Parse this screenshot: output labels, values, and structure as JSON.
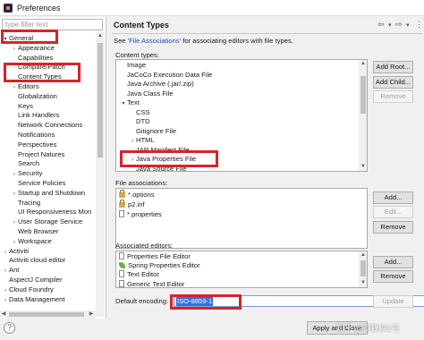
{
  "window": {
    "title": "Preferences"
  },
  "filter": {
    "placeholder": "type filter text"
  },
  "tree": [
    {
      "label": "General",
      "twisty": "down",
      "indent": 0
    },
    {
      "label": "Appearance",
      "twisty": "right",
      "indent": 1
    },
    {
      "label": "Capabilities",
      "twisty": "",
      "indent": 1
    },
    {
      "label": "Compare/Patch",
      "twisty": "",
      "indent": 1
    },
    {
      "label": "Content Types",
      "twisty": "",
      "indent": 1
    },
    {
      "label": "Editors",
      "twisty": "right",
      "indent": 1
    },
    {
      "label": "Globalization",
      "twisty": "",
      "indent": 1
    },
    {
      "label": "Keys",
      "twisty": "",
      "indent": 1
    },
    {
      "label": "Link Handlers",
      "twisty": "",
      "indent": 1
    },
    {
      "label": "Network Connections",
      "twisty": "",
      "indent": 1
    },
    {
      "label": "Notifications",
      "twisty": "",
      "indent": 1
    },
    {
      "label": "Perspectives",
      "twisty": "",
      "indent": 1
    },
    {
      "label": "Project Natures",
      "twisty": "",
      "indent": 1
    },
    {
      "label": "Search",
      "twisty": "",
      "indent": 1
    },
    {
      "label": "Security",
      "twisty": "right",
      "indent": 1
    },
    {
      "label": "Service Policies",
      "twisty": "",
      "indent": 1
    },
    {
      "label": "Startup and Shutdown",
      "twisty": "right",
      "indent": 1
    },
    {
      "label": "Tracing",
      "twisty": "",
      "indent": 1
    },
    {
      "label": "UI Responsiveness Mon",
      "twisty": "",
      "indent": 1
    },
    {
      "label": "User Storage Service",
      "twisty": "right",
      "indent": 1
    },
    {
      "label": "Web Browser",
      "twisty": "",
      "indent": 1
    },
    {
      "label": "Workspace",
      "twisty": "right",
      "indent": 1
    },
    {
      "label": "Activiti",
      "twisty": "right",
      "indent": 0
    },
    {
      "label": "Activiti cloud editor",
      "twisty": "",
      "indent": 0
    },
    {
      "label": "Ant",
      "twisty": "right",
      "indent": 0
    },
    {
      "label": "AspectJ Compiler",
      "twisty": "",
      "indent": 0
    },
    {
      "label": "Cloud Foundry",
      "twisty": "right",
      "indent": 0
    },
    {
      "label": "Data Management",
      "twisty": "right",
      "indent": 0
    }
  ],
  "page": {
    "title": "Content Types",
    "desc_prefix": "See ",
    "desc_link": "'File Associations'",
    "desc_suffix": " for associating editors with file types.",
    "content_types_label": "Content types:",
    "file_assoc_label": "File associations:",
    "assoc_editors_label": "Associated editors:",
    "encoding_label": "Default encoding:",
    "encoding_value": "ISO-8859-1",
    "nav_back": "⇦",
    "nav_fwd": "⇨",
    "nav_menu": "▾",
    "nav_more": "⋮"
  },
  "content_types": [
    {
      "label": "Image",
      "twisty": "",
      "indent": 0
    },
    {
      "label": "JaCoCo Execution Data File",
      "twisty": "",
      "indent": 0
    },
    {
      "label": "Java Archive (.jar/.zip)",
      "twisty": "",
      "indent": 0
    },
    {
      "label": "Java Class File",
      "twisty": "",
      "indent": 0
    },
    {
      "label": "Text",
      "twisty": "down",
      "indent": 0
    },
    {
      "label": "CSS",
      "twisty": "",
      "indent": 1
    },
    {
      "label": "DTD",
      "twisty": "",
      "indent": 1
    },
    {
      "label": "Gitignore File",
      "twisty": "",
      "indent": 1
    },
    {
      "label": "HTML",
      "twisty": "right",
      "indent": 1
    },
    {
      "label": "JAR Manifest File",
      "twisty": "",
      "indent": 1
    },
    {
      "label": "Java Properties File",
      "twisty": "right",
      "indent": 1
    },
    {
      "label": "Java Source File",
      "twisty": "",
      "indent": 1
    }
  ],
  "content_buttons": {
    "add_root": "Add Root...",
    "add_child": "Add Child...",
    "remove": "Remove"
  },
  "file_associations": [
    {
      "label": "*.options",
      "icon": "lock"
    },
    {
      "label": "p2.inf",
      "icon": "lock"
    },
    {
      "label": "*.properties",
      "icon": "file"
    }
  ],
  "file_buttons": {
    "add": "Add...",
    "edit": "Edit...",
    "remove": "Remove"
  },
  "editors": [
    {
      "label": "Properties File Editor",
      "icon": "file"
    },
    {
      "label": "Spring Properties Editor",
      "icon": "leaf"
    },
    {
      "label": "Text Editor",
      "icon": "file"
    },
    {
      "label": "Generic Text Editor",
      "icon": "file"
    }
  ],
  "editor_buttons": {
    "add": "Add...",
    "remove": "Remove"
  },
  "update_button": "Update",
  "footer": {
    "help_symbol": "?",
    "apply_close": "Apply and Close"
  },
  "watermark": "知乎 @钢铁侠1号",
  "colors": {
    "highlight": "#d8232a",
    "selection": "#3074d9",
    "link": "#1a4fbd"
  }
}
